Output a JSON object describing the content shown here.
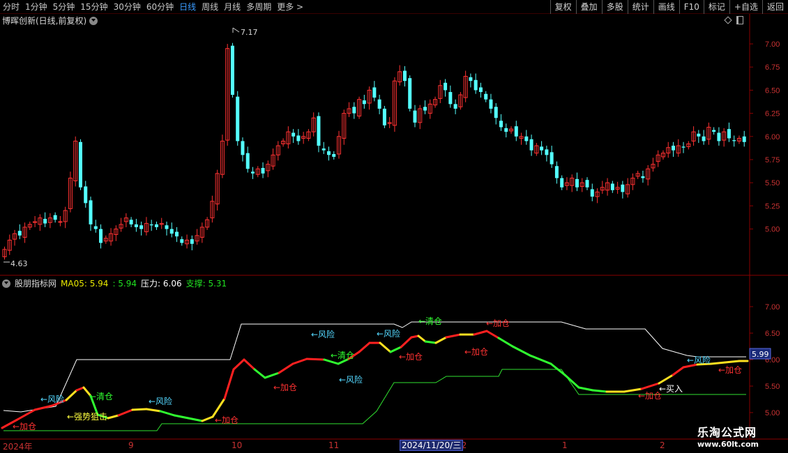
{
  "toolbar": {
    "periods": [
      "分时",
      "1分钟",
      "5分钟",
      "15分钟",
      "30分钟",
      "60分钟",
      "日线",
      "周线",
      "月线",
      "多周期",
      "更多 >"
    ],
    "active_period": "日线",
    "tools": [
      "复权",
      "叠加",
      "多股",
      "统计",
      "画线",
      "F10",
      "标记",
      "+自选",
      "返回"
    ]
  },
  "main_chart": {
    "stock_name": "博晖创新(日线,前复权)",
    "high_label": "7.17",
    "low_label": "4.63",
    "price_axis": [
      "7.00",
      "6.75",
      "6.50",
      "6.25",
      "6.00",
      "5.75",
      "5.50",
      "5.25",
      "5.00"
    ],
    "colors": {
      "up": "#ff3232",
      "down": "#54ffff",
      "background": "#000000"
    }
  },
  "indicator": {
    "name": "股朋指标网",
    "ma_label": "MA05: 5.94",
    "ma_value2": ": 5.94",
    "pressure_label": "压力: 6.06",
    "support_label": "支撑: 5.31",
    "price_axis": [
      "7.00",
      "6.50",
      "6.00",
      "5.50",
      "5.00"
    ],
    "current_value": "5.99",
    "annotations": [
      {
        "text": "←加仓",
        "color": "#ff3232"
      },
      {
        "text": "←风险",
        "color": "#54d8ff"
      },
      {
        "text": "←清仓",
        "color": "#30ff30"
      },
      {
        "text": "←强势狙击",
        "color": "#ffff40"
      },
      {
        "text": "←风险",
        "color": "#54d8ff"
      },
      {
        "text": "←加仓",
        "color": "#ff3232"
      },
      {
        "text": "←加仓",
        "color": "#ff3232"
      },
      {
        "text": "←风险",
        "color": "#54d8ff"
      },
      {
        "text": "←清仓",
        "color": "#30ff30"
      },
      {
        "text": "←加仓",
        "color": "#ff3232"
      },
      {
        "text": "←风险",
        "color": "#54d8ff"
      },
      {
        "text": "←加仓",
        "color": "#ff3232"
      },
      {
        "text": "←清仓",
        "color": "#30ff30"
      },
      {
        "text": "←加仓",
        "color": "#ff3232"
      },
      {
        "text": "←风险",
        "color": "#54d8ff"
      },
      {
        "text": "←加仓",
        "color": "#ff3232"
      },
      {
        "text": "←买入",
        "color": "#ffffff"
      },
      {
        "text": "←风险",
        "color": "#54d8ff"
      },
      {
        "text": "←加仓",
        "color": "#ff3232"
      }
    ]
  },
  "date_axis": {
    "labels": [
      "2024年",
      "9",
      "10",
      "11",
      "12",
      "1",
      "2"
    ],
    "cursor_date": "2024/11/20/三"
  },
  "watermark": {
    "title": "乐淘公式网",
    "url": "www.60lt.com"
  },
  "chart_data": {
    "type": "candlestick",
    "title": "博晖创新(日线,前复权)",
    "ylim": [
      4.6,
      7.2
    ],
    "max": 7.17,
    "min": 4.63,
    "closes": [
      4.78,
      4.88,
      4.95,
      4.93,
      5.02,
      5.05,
      5.08,
      5.12,
      5.06,
      5.12,
      5.1,
      5.08,
      5.2,
      5.55,
      5.95,
      5.45,
      5.28,
      5.05,
      5.0,
      4.85,
      4.9,
      4.95,
      5.0,
      5.05,
      5.12,
      5.05,
      5.02,
      5.0,
      5.06,
      5.04,
      5.02,
      5.06,
      5.0,
      4.95,
      4.92,
      4.85,
      4.88,
      4.84,
      4.93,
      5.02,
      5.1,
      5.3,
      5.6,
      5.95,
      6.95,
      6.45,
      5.95,
      5.8,
      5.65,
      5.6,
      5.65,
      5.6,
      5.7,
      5.8,
      5.9,
      5.95,
      6.05,
      6.0,
      5.95,
      6.0,
      6.05,
      6.2,
      5.9,
      5.85,
      5.8,
      5.78,
      6.0,
      6.25,
      6.3,
      6.25,
      6.4,
      6.35,
      6.5,
      6.42,
      6.3,
      6.12,
      6.15,
      6.6,
      6.7,
      6.6,
      6.3,
      6.15,
      6.3,
      6.28,
      6.35,
      6.4,
      6.55,
      6.5,
      6.35,
      6.3,
      6.45,
      6.65,
      6.6,
      6.5,
      6.48,
      6.4,
      6.3,
      6.2,
      6.1,
      6.05,
      6.08,
      6.0,
      6.0,
      5.95,
      5.85,
      5.9,
      5.85,
      5.8,
      5.7,
      5.55,
      5.45,
      5.5,
      5.55,
      5.45,
      5.5,
      5.45,
      5.35,
      5.4,
      5.45,
      5.5,
      5.42,
      5.45,
      5.4,
      5.48,
      5.55,
      5.6,
      5.55,
      5.65,
      5.7,
      5.8,
      5.82,
      5.88,
      5.85,
      5.9,
      5.88,
      5.92,
      6.05,
      6.0,
      5.95,
      6.1,
      6.05,
      5.95,
      6.05,
      5.98,
      5.95,
      5.98,
      5.94
    ]
  }
}
